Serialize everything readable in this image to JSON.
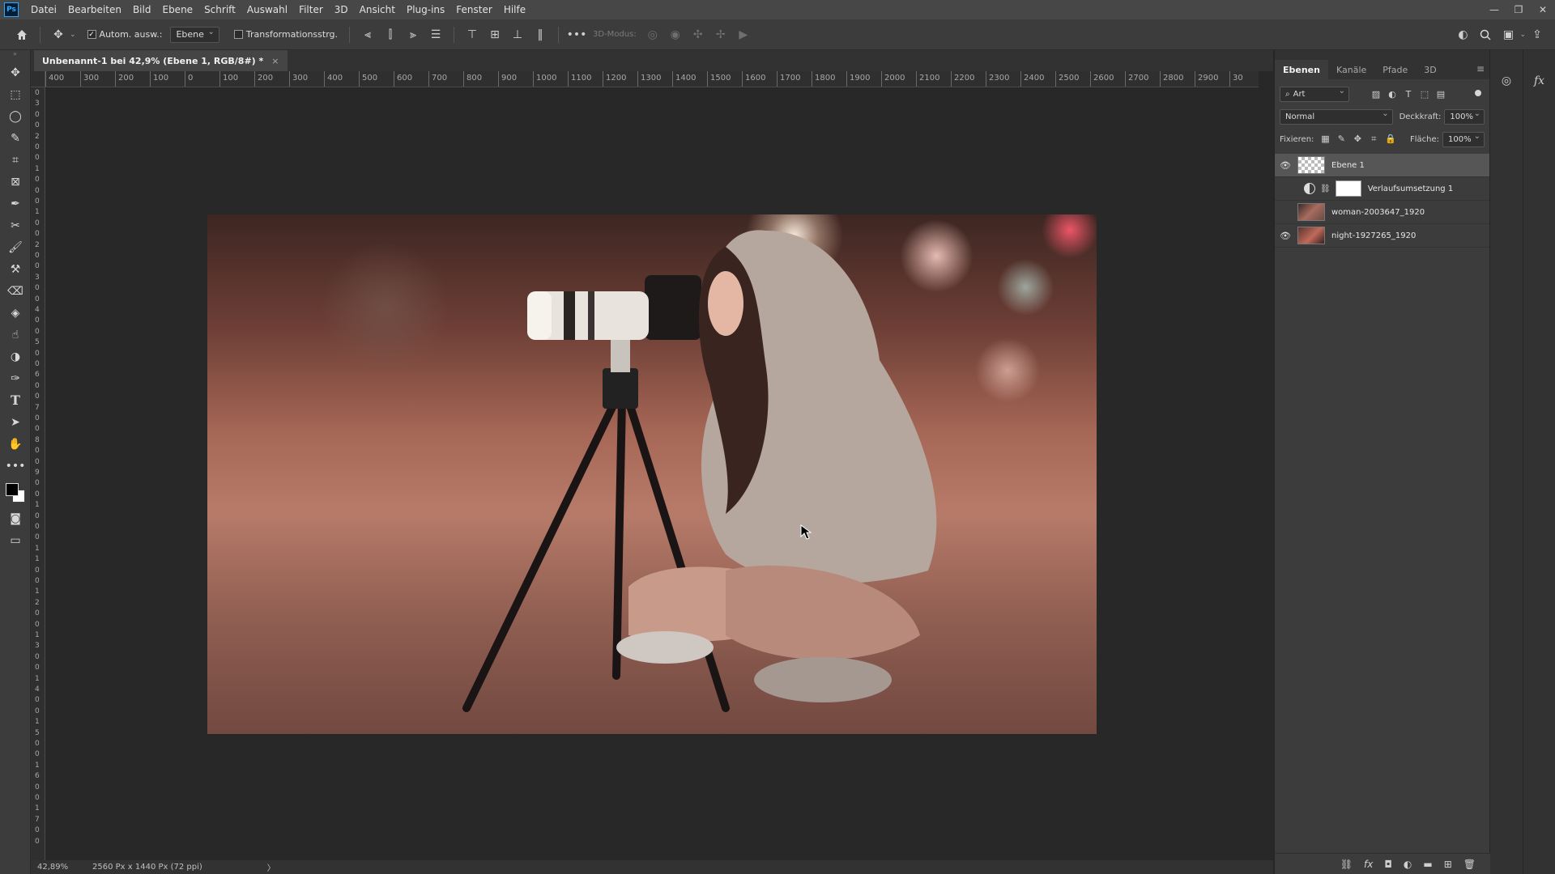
{
  "menu": {
    "logo": "Ps",
    "items": [
      "Datei",
      "Bearbeiten",
      "Bild",
      "Ebene",
      "Schrift",
      "Auswahl",
      "Filter",
      "3D",
      "Ansicht",
      "Plug-ins",
      "Fenster",
      "Hilfe"
    ]
  },
  "options": {
    "auto_select_label": "Autom. ausw.:",
    "auto_select_checked": true,
    "target_select": "Ebene",
    "transform_label": "Transformationsstrg.",
    "mode_3d_label": "3D-Modus:"
  },
  "document": {
    "tab_title": "Unbenannt-1 bei 42,9% (Ebene 1, RGB/8#) *",
    "close_glyph": "×"
  },
  "rulers": {
    "horizontal_ticks": [
      "400",
      "300",
      "200",
      "100",
      "0",
      "100",
      "200",
      "300",
      "400",
      "500",
      "600",
      "700",
      "800",
      "900",
      "1000",
      "1100",
      "1200",
      "1300",
      "1400",
      "1500",
      "1600",
      "1700",
      "1800",
      "1900",
      "2000",
      "2100",
      "2200",
      "2300",
      "2400",
      "2500",
      "2600",
      "2700",
      "2800",
      "2900",
      "30"
    ],
    "vertical_ticks": [
      "0",
      "3",
      "0",
      "0",
      "2",
      "0",
      "0",
      "1",
      "0",
      "0",
      "0",
      "1",
      "0",
      "0",
      "2",
      "0",
      "0",
      "3",
      "0",
      "0",
      "4",
      "0",
      "0",
      "5",
      "0",
      "0",
      "6",
      "0",
      "0",
      "7",
      "0",
      "0",
      "8",
      "0",
      "0",
      "9",
      "0",
      "0",
      "1",
      "0",
      "0",
      "0",
      "1",
      "1",
      "0",
      "0",
      "1",
      "2",
      "0",
      "0",
      "1",
      "3",
      "0",
      "0",
      "1",
      "4",
      "0",
      "0",
      "1",
      "5",
      "0",
      "0",
      "1",
      "6",
      "0",
      "0",
      "1",
      "7",
      "0",
      "0"
    ]
  },
  "status": {
    "zoom": "42,89%",
    "doc_info": "2560 Px x 1440 Px (72 ppi)",
    "arrow": "〉"
  },
  "layers_panel": {
    "tabs": [
      "Ebenen",
      "Kanäle",
      "Pfade",
      "3D"
    ],
    "active_tab": "Ebenen",
    "filter_kind": "Art",
    "blend_mode": "Normal",
    "opacity_label": "Deckkraft:",
    "opacity_value": "100%",
    "lock_label": "Fixieren:",
    "fill_label": "Fläche:",
    "fill_value": "100%",
    "layers": [
      {
        "name": "Ebene 1",
        "visible": true,
        "selected": true
      },
      {
        "name": "Verlaufsumsetzung 1",
        "visible": false,
        "selected": false
      },
      {
        "name": "woman-2003647_1920",
        "visible": false,
        "selected": false
      },
      {
        "name": "night-1927265_1920",
        "visible": true,
        "selected": false
      }
    ]
  },
  "colors": {
    "foreground": "#000000",
    "background": "#ffffff",
    "accent": "#31a8ff"
  }
}
